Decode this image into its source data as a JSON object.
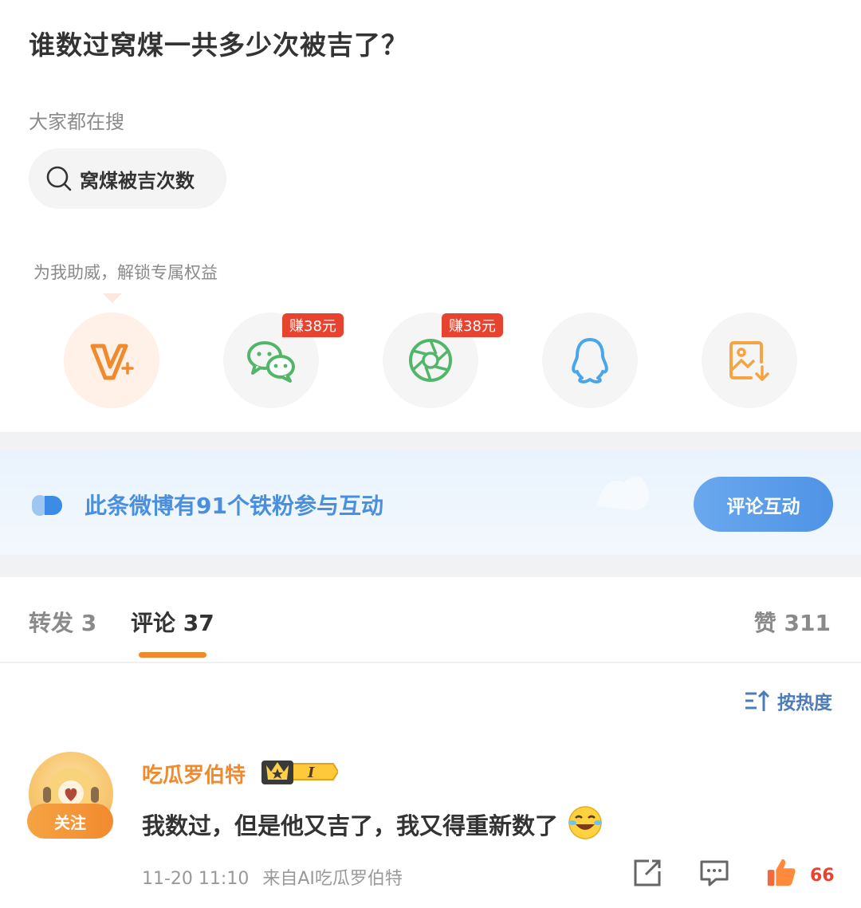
{
  "question": "谁数过窝煤一共多少次被吉了？",
  "search_hints": {
    "title": "大家都在搜",
    "chip": "窝煤被吉次数"
  },
  "boost": {
    "title": "为我助威，解锁专属权益",
    "items": [
      {
        "icon": "vip-plus-icon",
        "badge": ""
      },
      {
        "icon": "wechat-icon",
        "badge": "赚38元"
      },
      {
        "icon": "moments-icon",
        "badge": "赚38元"
      },
      {
        "icon": "qq-icon",
        "badge": ""
      },
      {
        "icon": "save-image-icon",
        "badge": ""
      }
    ]
  },
  "fan_banner": {
    "text": "此条微博有91个铁粉参与互动",
    "button": "评论互动"
  },
  "tabs": {
    "repost": "转发 3",
    "comment": "评论 37",
    "like": "赞 311"
  },
  "sort_label": "按热度",
  "comment": {
    "username": "吃瓜罗伯特",
    "level": "I",
    "follow": "关注",
    "text": "我数过，但是他又吉了，我又得重新数了",
    "emoji": "laugh-cry-emoji",
    "time": "11-20 11:10",
    "source": "来自AI吃瓜罗伯特",
    "likes": "66"
  },
  "colors": {
    "accent_orange": "#f08a2c",
    "link_blue": "#4a8fde",
    "badge_red": "#e8432f"
  }
}
